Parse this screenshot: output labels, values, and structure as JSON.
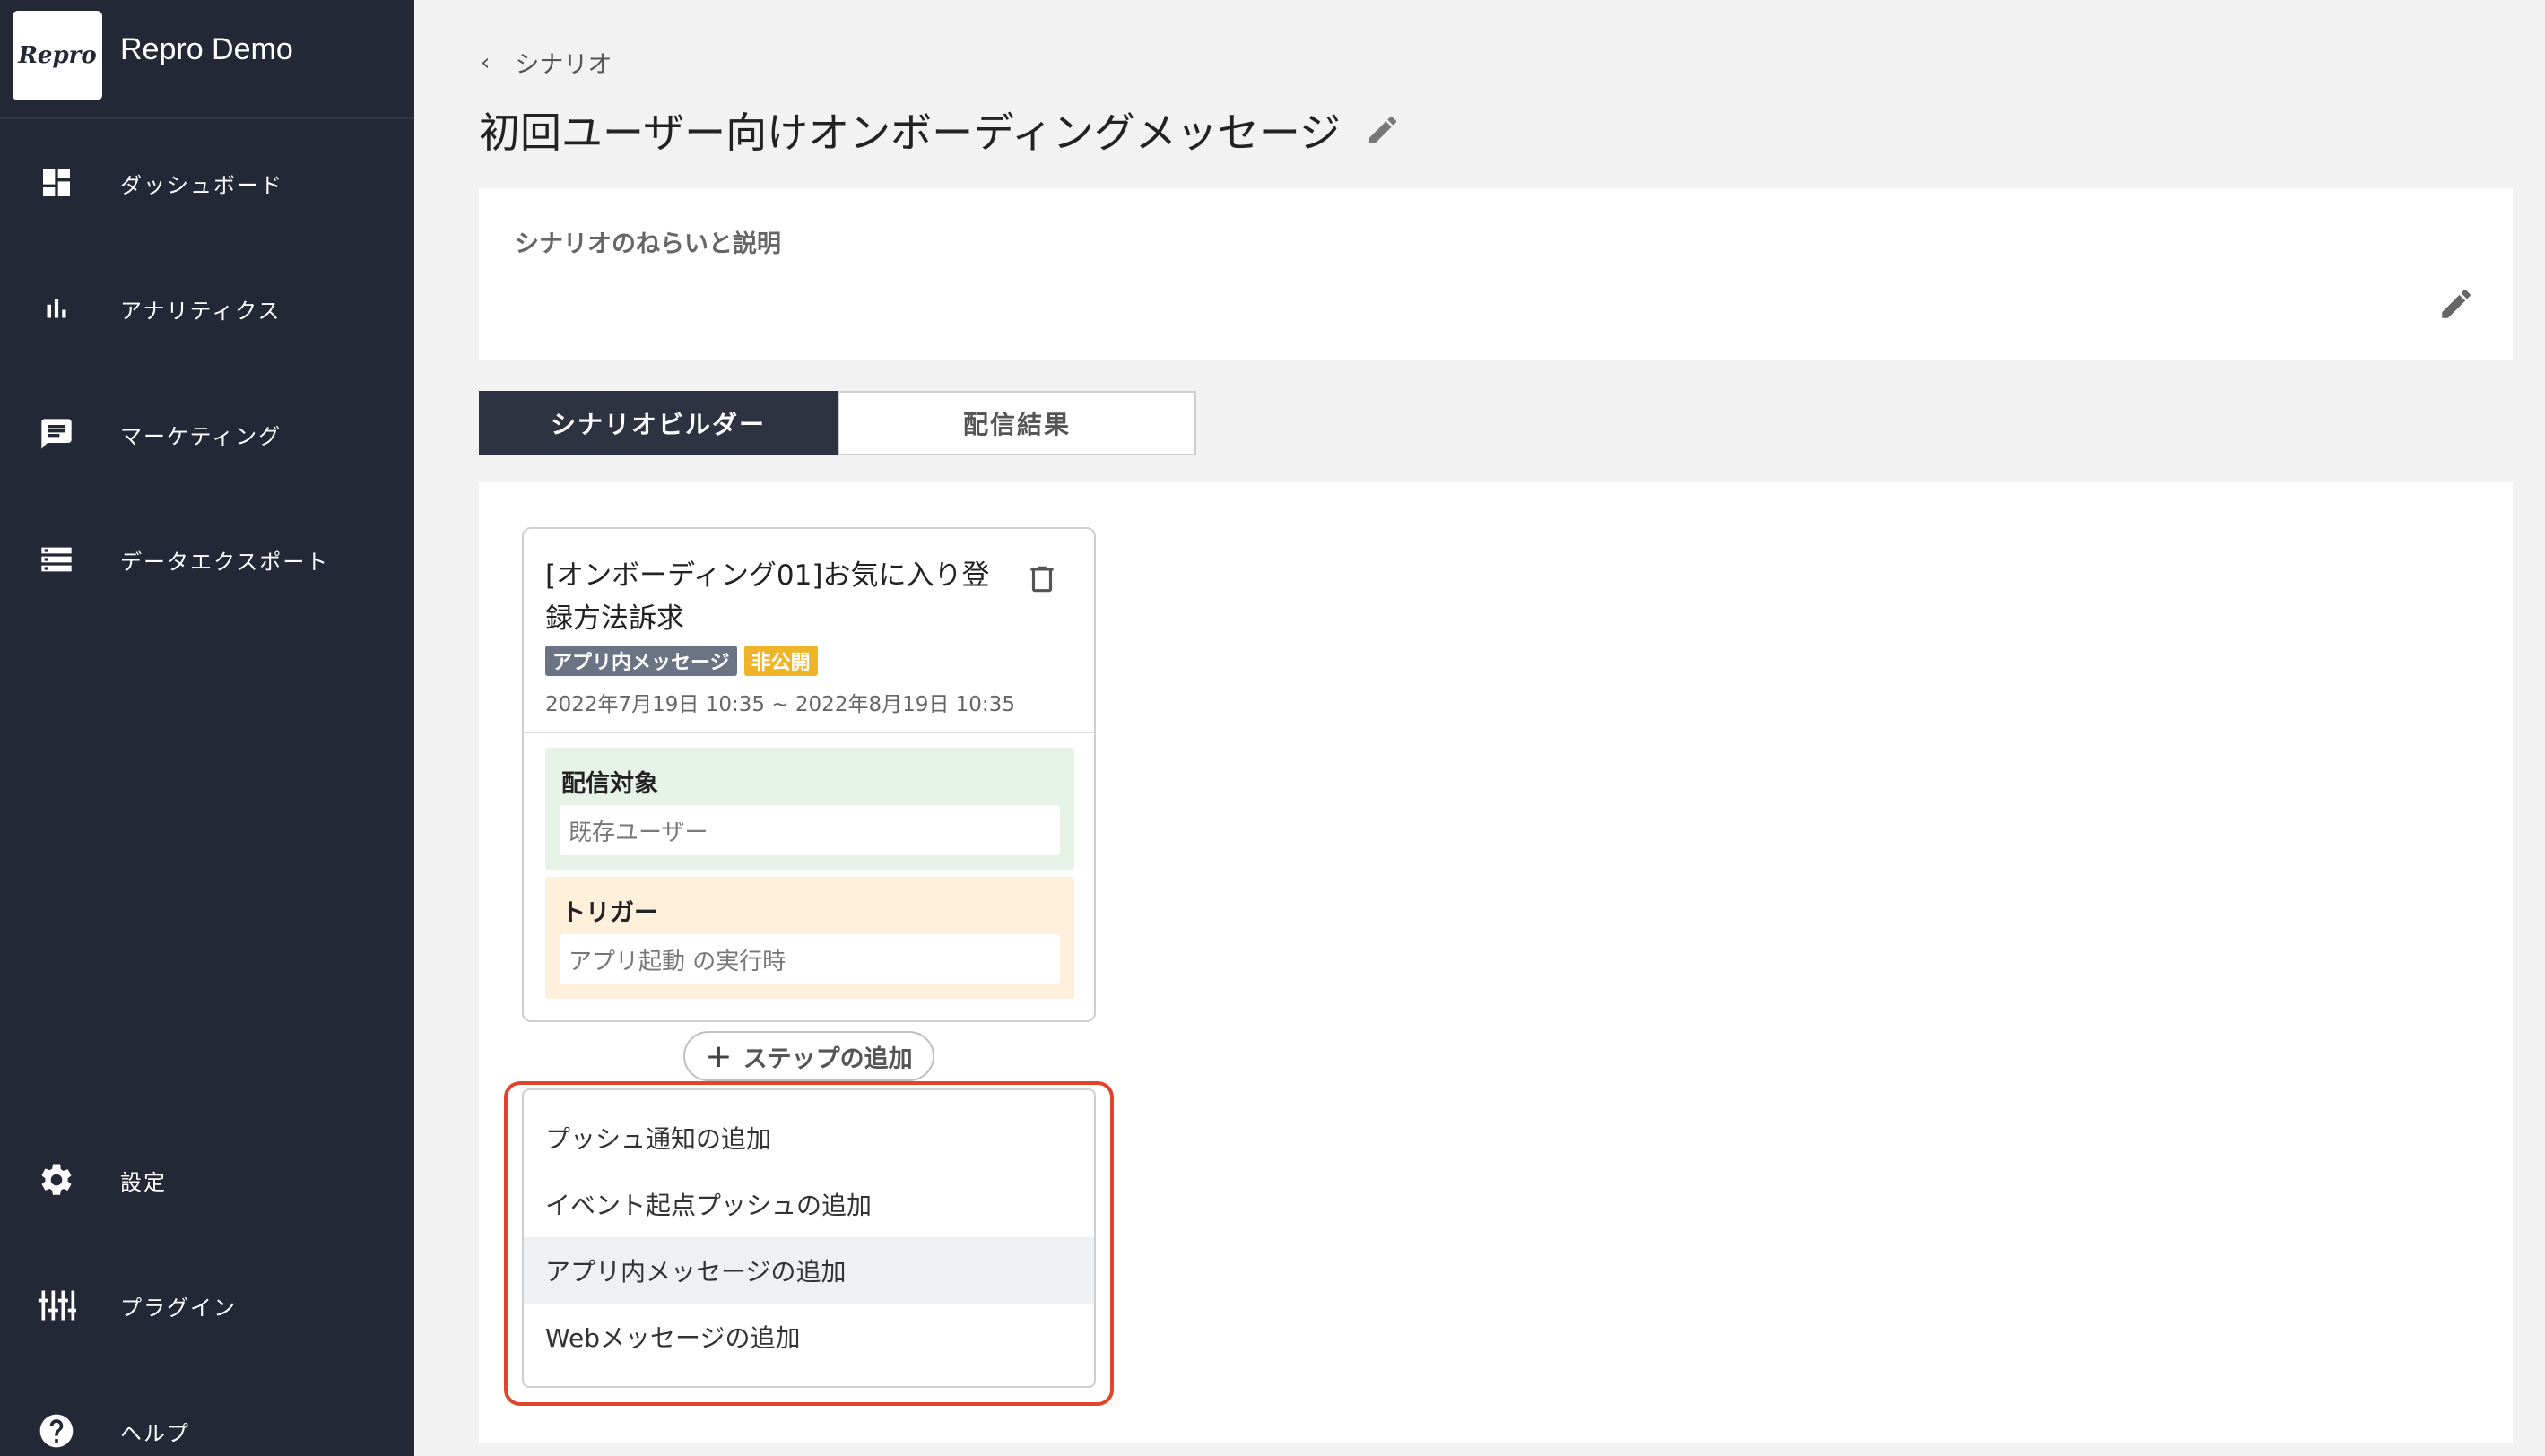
{
  "app": {
    "logo_text": "Repro",
    "name": "Repro Demo"
  },
  "sidebar": {
    "items": [
      {
        "label": "ダッシュボード",
        "icon": "dashboard-icon"
      },
      {
        "label": "アナリティクス",
        "icon": "bar-chart-icon"
      },
      {
        "label": "マーケティング",
        "icon": "message-icon"
      },
      {
        "label": "データエクスポート",
        "icon": "storage-icon"
      }
    ],
    "bottom_items": [
      {
        "label": "設定",
        "icon": "gear-icon"
      },
      {
        "label": "プラグイン",
        "icon": "plugin-icon"
      },
      {
        "label": "ヘルプ",
        "icon": "help-icon"
      }
    ]
  },
  "breadcrumb": {
    "label": "シナリオ"
  },
  "page": {
    "title": "初回ユーザー向けオンボーディングメッセージ"
  },
  "description": {
    "label": "シナリオのねらいと説明"
  },
  "tabs": [
    {
      "label": "シナリオビルダー",
      "active": true
    },
    {
      "label": "配信結果",
      "active": false
    }
  ],
  "step": {
    "title": "[オンボーディング01]お気に入り登録方法訴求",
    "type_badge": "アプリ内メッセージ",
    "status_badge": "非公開",
    "period": "2022年7月19日 10:35 ~ 2022年8月19日 10:35",
    "target": {
      "label": "配信対象",
      "value": "既存ユーザー"
    },
    "trigger": {
      "label": "トリガー",
      "value": "アプリ起動 の実行時"
    }
  },
  "add_step": {
    "label": "ステップの追加"
  },
  "add_menu": {
    "items": [
      {
        "label": "プッシュ通知の追加"
      },
      {
        "label": "イベント起点プッシュの追加"
      },
      {
        "label": "アプリ内メッセージの追加"
      },
      {
        "label": "Webメッセージの追加"
      }
    ]
  },
  "colors": {
    "sidebar_bg": "#222835",
    "active_tab_bg": "#2d3340",
    "status_badge": "#f0b429",
    "type_badge": "#6b7485",
    "highlight_border": "#e0462c"
  }
}
